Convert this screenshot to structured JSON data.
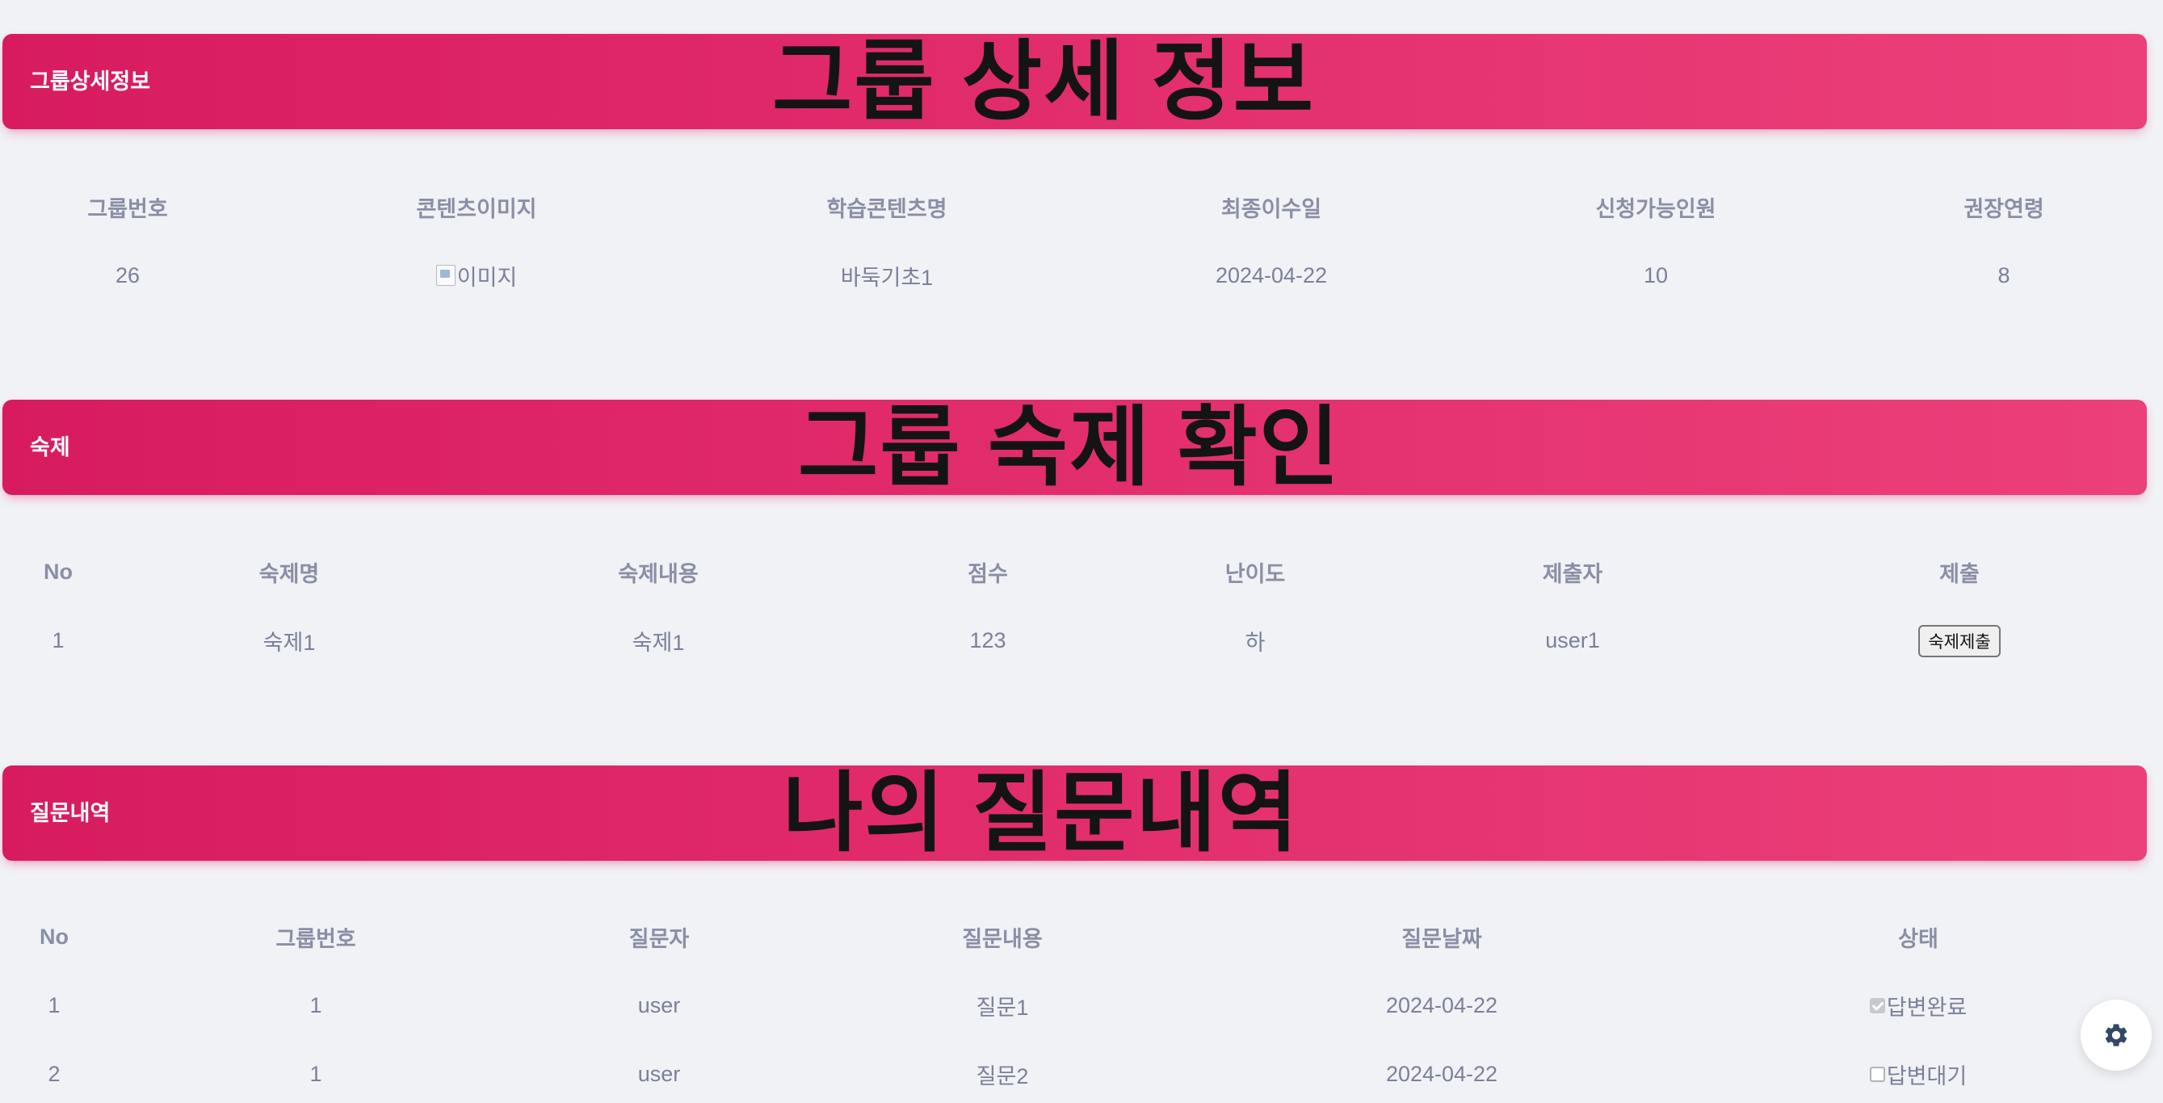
{
  "group_detail": {
    "title": "그룹상세정보",
    "caption": "그룹 상세 정보",
    "columns": [
      "그룹번호",
      "콘텐츠이미지",
      "학습콘텐츠명",
      "최종이수일",
      "신청가능인원",
      "권장연령"
    ],
    "row": {
      "group_no": "26",
      "image_alt": "이미지",
      "content_name": "바둑기초1",
      "completion_date": "2024-04-22",
      "capacity": "10",
      "recommended_age": "8"
    }
  },
  "homework": {
    "title": "숙제",
    "caption": "그룹 숙제 확인",
    "columns": [
      "No",
      "숙제명",
      "숙제내용",
      "점수",
      "난이도",
      "제출자",
      "제출"
    ],
    "rows": [
      {
        "no": "1",
        "name": "숙제1",
        "content": "숙제1",
        "score": "123",
        "difficulty": "하",
        "submitter": "user1",
        "action_label": "숙제제출"
      }
    ]
  },
  "questions": {
    "title": "질문내역",
    "caption": "나의 질문내역",
    "columns": [
      "No",
      "그룹번호",
      "질문자",
      "질문내용",
      "질문날짜",
      "상태"
    ],
    "rows": [
      {
        "no": "1",
        "group_no": "1",
        "asker": "user",
        "content": "질문1",
        "date": "2024-04-22",
        "status": "답변완료",
        "answered": true
      },
      {
        "no": "2",
        "group_no": "1",
        "asker": "user",
        "content": "질문2",
        "date": "2024-04-22",
        "status": "답변대기",
        "answered": false
      }
    ]
  },
  "settings_button": {
    "icon": "gear-icon"
  },
  "colors": {
    "accent_start": "#d81b60",
    "accent_end": "#ec407a",
    "background": "#f0f2f5",
    "text_muted": "#7b809a",
    "icon_dark": "#344767"
  }
}
